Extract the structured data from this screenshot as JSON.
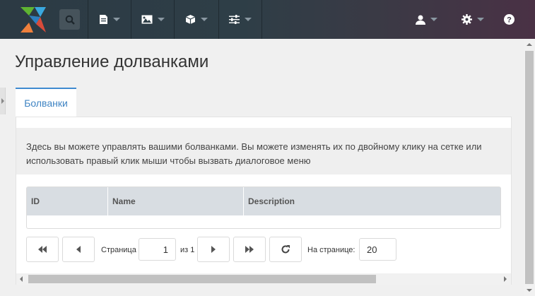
{
  "topbar": {
    "menus": [
      {
        "icon": "document-icon"
      },
      {
        "icon": "image-icon"
      },
      {
        "icon": "package-icon"
      },
      {
        "icon": "sliders-icon"
      }
    ],
    "right": [
      {
        "icon": "user-icon"
      },
      {
        "icon": "gear-icon"
      },
      {
        "icon": "help-icon"
      }
    ]
  },
  "page": {
    "title": "Управление долванками"
  },
  "tabs": [
    {
      "label": "Болванки",
      "active": true
    }
  ],
  "description": "Здесь вы можете управлять вашими болванками. Вы можете изменять их по двойному клику на сетке или использовать правый клик мыши чтобы вызвать диалоговое меню",
  "grid": {
    "columns": [
      "ID",
      "Name",
      "Description"
    ],
    "rows": []
  },
  "pagination": {
    "page_label": "Страница",
    "page_value": "1",
    "of_label": "из 1",
    "per_page_label": "На странице:",
    "per_page_value": "20"
  },
  "colors": {
    "accent": "#3f84c3",
    "topbar": "#2e3e47"
  }
}
